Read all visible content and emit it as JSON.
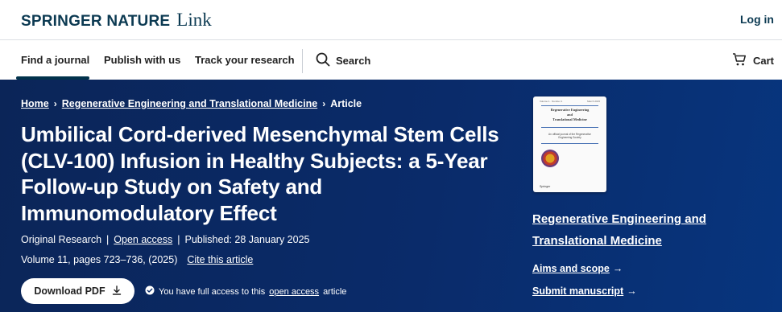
{
  "header": {
    "logo_brand": "SPRINGER NATURE",
    "logo_product": "Link",
    "login_label": "Log in"
  },
  "nav": {
    "items": [
      {
        "label": "Find a journal"
      },
      {
        "label": "Publish with us"
      },
      {
        "label": "Track your research"
      }
    ],
    "search_label": "Search",
    "cart_label": "Cart"
  },
  "breadcrumb": {
    "home": "Home",
    "journal": "Regenerative Engineering and Translational Medicine",
    "current": "Article"
  },
  "article": {
    "title": "Umbilical Cord-derived Mesenchymal Stem Cells (CLV-100) Infusion in Healthy Subjects: a 5-Year Follow-up Study on Safety and Immunomodulatory Effect",
    "type": "Original Research",
    "separator": "|",
    "open_access": "Open access",
    "published": "Published: 28 January 2025",
    "volume": "Volume 11, pages 723–736, (2025)",
    "cite": "Cite this article",
    "download_pdf": "Download PDF",
    "access_prefix": "You have full access to this",
    "access_link": "open access",
    "access_suffix": "article"
  },
  "cover": {
    "header_left": "Volume 1 · Number 1",
    "header_right": "March 2015",
    "title_lines": [
      "Regenerative Engineering",
      "and",
      "Translational Medicine"
    ],
    "subtitle": "An official journal of the Regenerative Engineering Society",
    "publisher": "Springer"
  },
  "sidebar": {
    "journal_name": "Regenerative Engineering and Translational Medicine",
    "aims_scope": "Aims and scope",
    "submit": "Submit manuscript",
    "arrow": "→"
  },
  "colors": {
    "brand": "#0c3a52",
    "hero_bg": "#0a2b6a",
    "nav_active": "#01324b"
  }
}
